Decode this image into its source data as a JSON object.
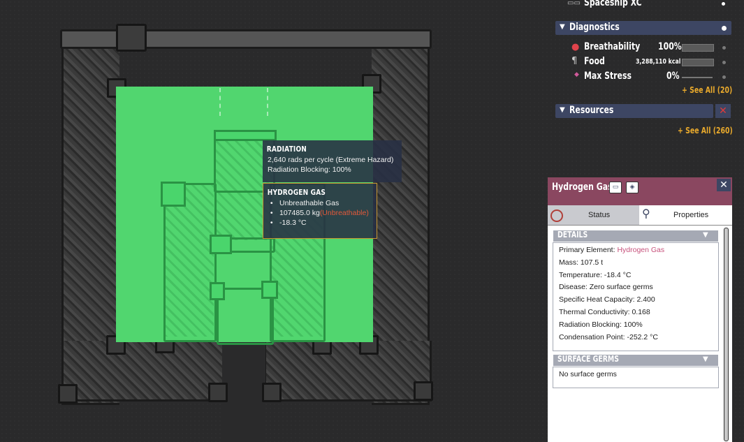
{
  "hud": {
    "ship_name": "Spaceship XC",
    "diagnostics": {
      "title": "Diagnostics",
      "rows": [
        {
          "label": "Breathability",
          "value": "100%"
        },
        {
          "label": "Food",
          "value": "3,288,110 kcal"
        },
        {
          "label": "Max Stress",
          "value": "0%"
        }
      ],
      "see_all": "+ See All (20)"
    },
    "resources": {
      "title": "Resources",
      "see_all": "+ See All (260)"
    }
  },
  "tooltip": {
    "radiation": {
      "title": "RADIATION",
      "line1": "2,640 rads per cycle (Extreme Hazard)",
      "line2": "Radiation Blocking: 100%"
    },
    "hydrogen": {
      "title": "HYDROGEN GAS",
      "item1": "Unbreathable Gas",
      "item2_value": "107485.0 kg",
      "item2_warn": "(Unbreathable)",
      "item3": "-18.3 °C"
    }
  },
  "panel": {
    "title": "Hydrogen Gas",
    "tabs": {
      "status": "Status",
      "properties": "Properties"
    },
    "details": {
      "header": "DETAILS",
      "primary_label": "Primary Element: ",
      "primary_value": "Hydrogen Gas",
      "mass": "Mass: 107.5 t",
      "temperature": "Temperature: -18.4 °C",
      "disease": "Disease: Zero surface germs",
      "shc": "Specific Heat Capacity: 2.400",
      "thermal": "Thermal Conductivity: 0.168",
      "radiation": "Radiation Blocking: 100%",
      "condensation": "Condensation Point: -252.2 °C"
    },
    "germs": {
      "header": "SURFACE GERMS",
      "text": "No surface germs"
    }
  },
  "colors": {
    "gas_green": "#54ec76",
    "panel_header": "#8a4760",
    "hud_bar": "#3d4663",
    "see_all_orange": "#e8a92c",
    "warning_red": "#e2593a",
    "element_pink": "#c7527c"
  }
}
